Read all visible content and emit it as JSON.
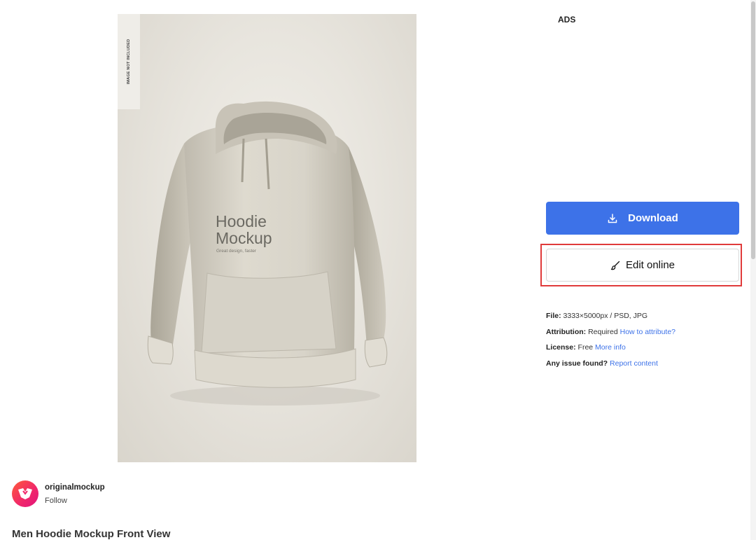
{
  "preview": {
    "tag": "IMAGE NOT INCLUDED",
    "print_title": "Hoodie\nMockup",
    "print_subtitle": "Great design, faster"
  },
  "ads_label": "ADS",
  "actions": {
    "download_label": "Download",
    "edit_label": "Edit online"
  },
  "info": {
    "file_label": "File:",
    "file_value": "3333×5000px / PSD, JPG",
    "attribution_label": "Attribution:",
    "attribution_value": "Required",
    "attribution_link": "How to attribute?",
    "license_label": "License:",
    "license_value": "Free",
    "license_link": "More info",
    "issue_label": "Any issue found?",
    "issue_link": "Report content"
  },
  "author": {
    "name": "originalmockup",
    "follow_label": "Follow"
  },
  "title": "Men Hoodie Mockup Front View",
  "colors": {
    "primary": "#3d72e8",
    "highlight": "#e03b3b"
  }
}
